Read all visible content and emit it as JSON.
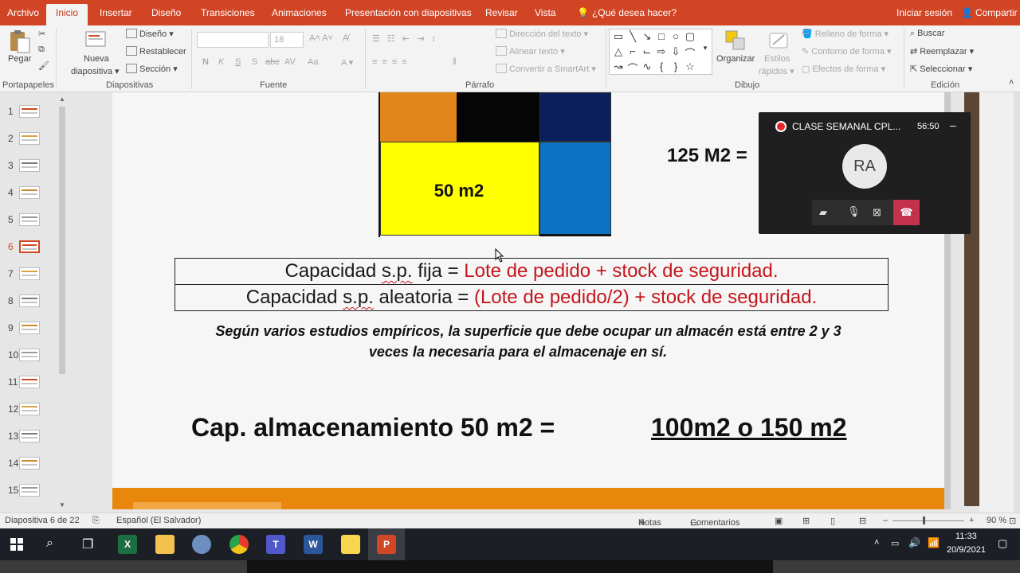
{
  "tabs": {
    "archivo": "Archivo",
    "inicio": "Inicio",
    "insertar": "Insertar",
    "diseno": "Diseño",
    "transiciones": "Transiciones",
    "animaciones": "Animaciones",
    "presentacion": "Presentación con diapositivas",
    "revisar": "Revisar",
    "vista": "Vista",
    "tell_me": "¿Qué desea hacer?",
    "sign_in": "Iniciar sesión",
    "share": "Compartir"
  },
  "ribbon": {
    "pegar": "Pegar",
    "portapapeles": "Portapapeles",
    "nueva": "Nueva",
    "diapositiva": "diapositiva",
    "diseno": "Diseño",
    "restablecer": "Restablecer",
    "seccion": "Sección",
    "diapositivas": "Diapositivas",
    "font_size": "18",
    "fuente": "Fuente",
    "font_bold": "N",
    "font_italic": "K",
    "font_underline": "S",
    "font_strike": "S",
    "font_abc": "abc",
    "font_av": "AV",
    "font_aa": "Aa",
    "direccion_texto": "Dirección del texto",
    "alinear_texto": "Alinear texto",
    "convertir_smartart": "Convertir a SmartArt",
    "parrafo": "Párrafo",
    "organizar": "Organizar",
    "estilos": "Estilos",
    "rapidos": "rápidos",
    "relleno": "Relleno de forma",
    "contorno": "Contorno de forma",
    "efectos": "Efectos de forma",
    "dibujo": "Dibujo",
    "buscar": "Buscar",
    "reemplazar": "Reemplazar",
    "seleccionar": "Seleccionar",
    "edicion": "Edición"
  },
  "slide_numbers": [
    "1",
    "2",
    "3",
    "4",
    "5",
    "6",
    "7",
    "8",
    "9",
    "10",
    "11",
    "12",
    "13",
    "14",
    "15"
  ],
  "slide": {
    "cell_label": "50 m2",
    "m2_label": "125 M2 =",
    "formula1_prefix": "Capacidad ",
    "formula1_sp": "s.p.",
    "formula1_mid": " fija = ",
    "formula1_red": "Lote de pedido + stock de seguridad.",
    "formula2_prefix": "Capacidad ",
    "formula2_sp": "s.p.",
    "formula2_mid": " aleatoria = ",
    "formula2_red": "(Lote de pedido/2) + stock de seguridad.",
    "note_line1": "Según varios estudios empíricos, la superficie que debe ocupar un almacén está entre 2 y 3",
    "note_line2": "veces la necesaria para el almacenaje en sí.",
    "cap_label": "Cap. almacenamiento 50 m2 =",
    "cap_result": "100m2 o 150 m2"
  },
  "call": {
    "title": "CLASE SEMANAL CPL...",
    "timer": "56:50",
    "avatar": "RA"
  },
  "status": {
    "slide_count": "Diapositiva 6 de 22",
    "language": "Español (El Salvador)",
    "notas": "Notas",
    "comentarios": "Comentarios",
    "zoom": "90 %"
  },
  "taskbar": {
    "time": "11:33",
    "date": "20/9/2021"
  },
  "colors": {
    "accent": "#d14424",
    "orange": "#e0861a",
    "navy": "#0a1f5c",
    "blue": "#0b72c4",
    "yellow": "#ffff00",
    "red_text": "#c4161c"
  }
}
